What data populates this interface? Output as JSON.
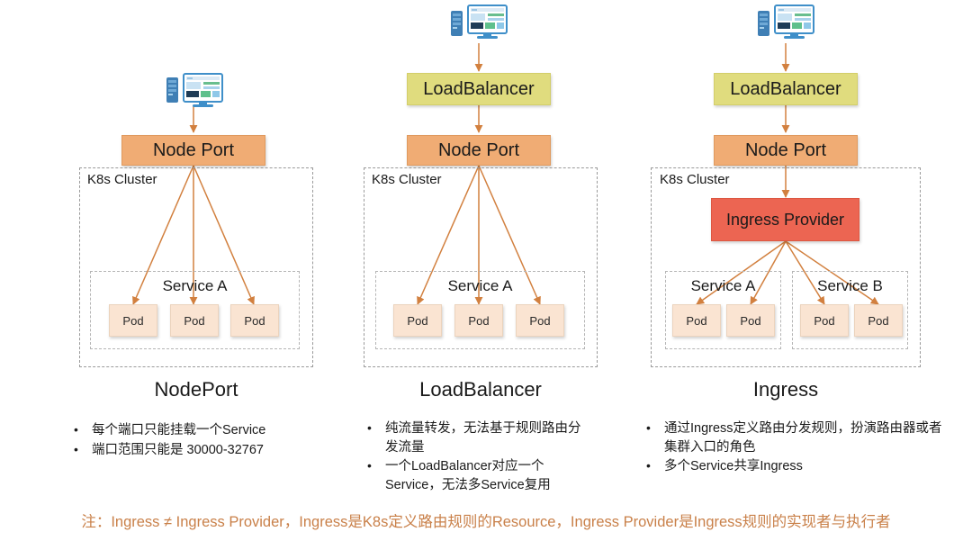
{
  "diagram": {
    "title_hidden": "",
    "colors": {
      "node_port": "#F0AC74",
      "load_balancer": "#E0DC7E",
      "ingress_provider": "#EC6552",
      "pod": "#FAE4D2",
      "arrow": "#D2803F",
      "footnote": "#C98049",
      "dashed_border": "#9a9a9a"
    },
    "columns": [
      {
        "id": "nodeport",
        "caption": "NodePort",
        "client_icon": "computer-server-icon",
        "nodes": [
          {
            "name": "node-port-box",
            "label": "Node Port",
            "style": "node"
          }
        ],
        "cluster_label": "K8s Cluster",
        "services": [
          {
            "label": "Service A",
            "pods": [
              "Pod",
              "Pod",
              "Pod"
            ]
          }
        ],
        "bullets": [
          "每个端口只能挂载一个Service",
          "端口范围只能是 30000-32767"
        ]
      },
      {
        "id": "loadbalancer",
        "caption": "LoadBalancer",
        "client_icon": "computer-server-icon",
        "nodes": [
          {
            "name": "load-balancer-box",
            "label": "LoadBalancer",
            "style": "lb"
          },
          {
            "name": "node-port-box",
            "label": "Node Port",
            "style": "node"
          }
        ],
        "cluster_label": "K8s Cluster",
        "services": [
          {
            "label": "Service A",
            "pods": [
              "Pod",
              "Pod",
              "Pod"
            ]
          }
        ],
        "bullets": [
          "纯流量转发，无法基于规则路由分发流量",
          "一个LoadBalancer对应一个Service，无法多Service复用"
        ]
      },
      {
        "id": "ingress",
        "caption": "Ingress",
        "client_icon": "computer-server-icon",
        "nodes": [
          {
            "name": "load-balancer-box",
            "label": "LoadBalancer",
            "style": "lb"
          },
          {
            "name": "node-port-box",
            "label": "Node Port",
            "style": "node"
          },
          {
            "name": "ingress-provider-box",
            "label": "Ingress Provider",
            "style": "ingress"
          }
        ],
        "cluster_label": "K8s Cluster",
        "services": [
          {
            "label": "Service A",
            "pods": [
              "Pod",
              "Pod"
            ]
          },
          {
            "label": "Service B",
            "pods": [
              "Pod",
              "Pod"
            ]
          }
        ],
        "bullets": [
          "通过Ingress定义路由分发规则，扮演路由器或者集群入口的角色",
          "多个Service共享Ingress"
        ]
      }
    ],
    "footnote": "注：Ingress ≠ Ingress Provider，Ingress是K8s定义路由规则的Resource，Ingress Provider是Ingress规则的实现者与执行者"
  }
}
